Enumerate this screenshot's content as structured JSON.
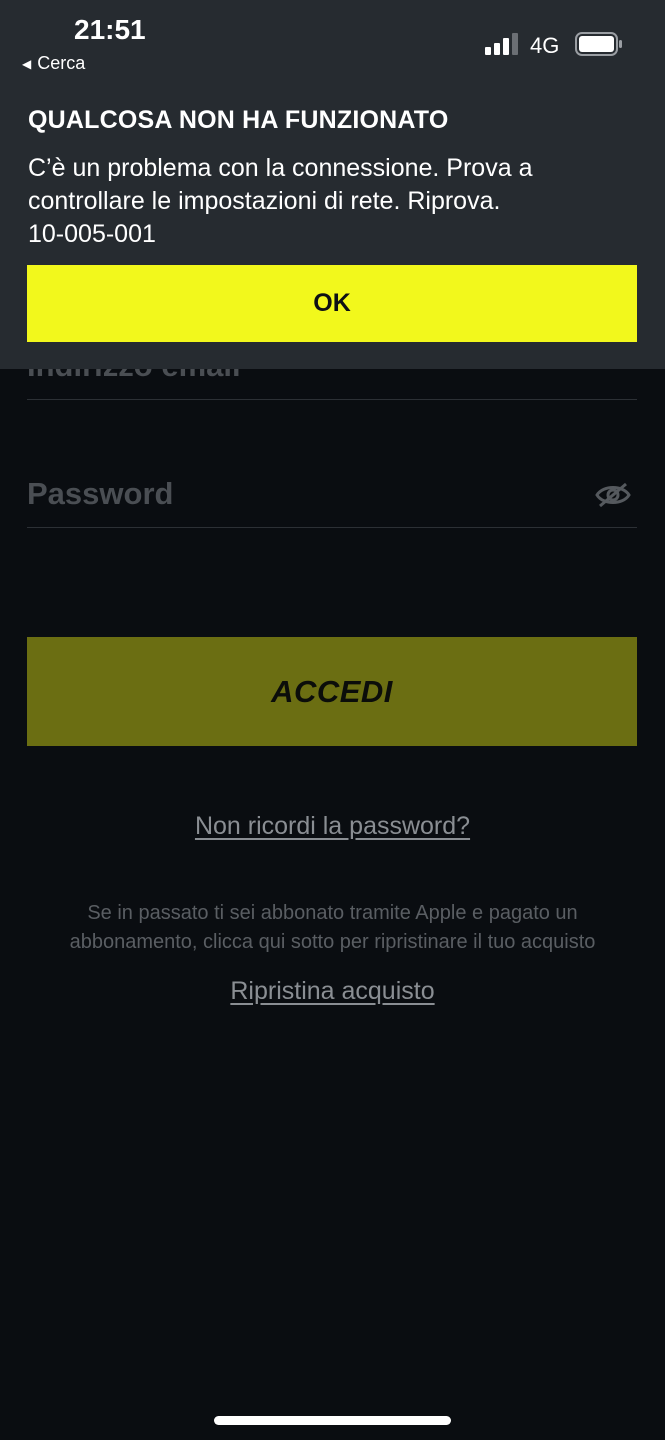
{
  "status_bar": {
    "time": "21:51",
    "back_app": "Cerca",
    "network": "4G"
  },
  "alert": {
    "title": "QUALCOSA NON HA FUNZIONATO",
    "message_lines": [
      "C’è un problema con la connessione. Prova a",
      "controllare le impostazioni di rete. Riprova.",
      "10-005-001"
    ],
    "ok_label": "OK"
  },
  "login": {
    "email_label": "Indirizzo email",
    "password_placeholder": "Password",
    "login_button": "ACCEDI",
    "forgot_password": "Non ricordi la password?",
    "restore_note_lines": [
      "Se in passato ti sei abbonato tramite Apple e pagato un",
      "abbonamento, clicca qui sotto per ripristinare il tuo acquisto"
    ],
    "restore_purchase": "Ripristina acquisto"
  },
  "icons": {
    "eye": "eye-slash-icon",
    "signal": "signal-bars-icon",
    "battery": "battery-icon",
    "back": "back-triangle-icon"
  },
  "colors": {
    "accent": "#f2f81c",
    "accent_dimmed": "#6b6e12",
    "background": "#0a0d11",
    "banner": "#262b30"
  }
}
